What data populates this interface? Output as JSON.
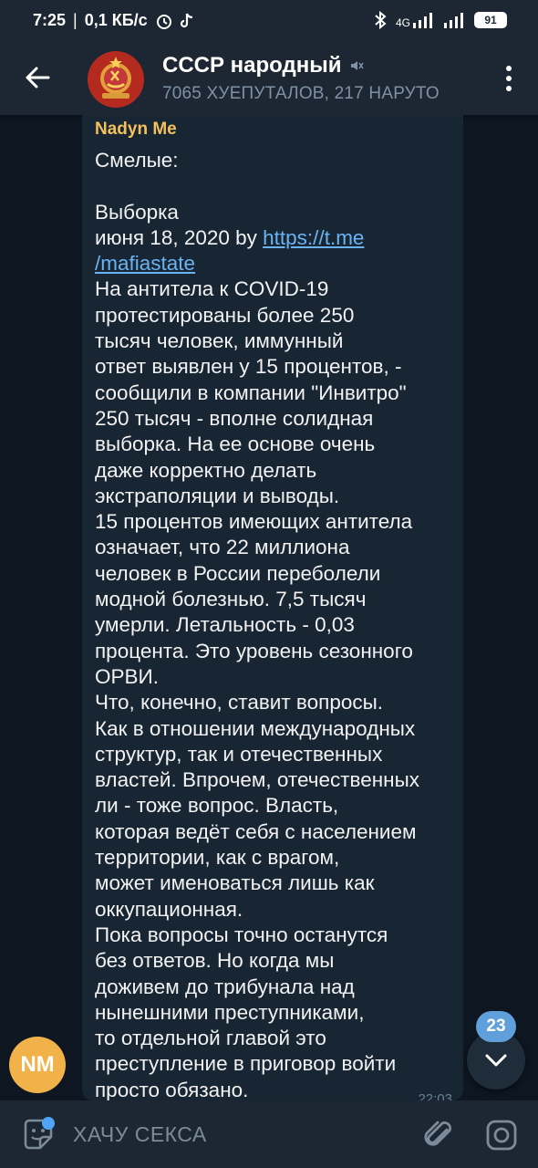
{
  "status_bar": {
    "time": "7:25",
    "speed": "0,1 КБ/с",
    "network_label": "4G",
    "battery": "91",
    "icons": [
      "alarm-icon",
      "tiktok-icon",
      "bluetooth-icon",
      "signal-icon",
      "signal-icon"
    ]
  },
  "header": {
    "title": "СССР народный",
    "subtitle": "7065 ХУЕПУТАЛОВ, 217 НАРУТО",
    "muted_icon": "mute-icon"
  },
  "message": {
    "sender": "Nadyn Me",
    "lines_before_link": "Смелые:\n\nВыборка\nиюня 18, 2020 by ",
    "link": "https://t.me\n/mafiastate",
    "lines_after_link": "\nНа антитела к COVID-19\nпротестированы более 250\nтысяч человек, иммунный\nответ выявлен у 15 процентов, -\nсообщили в компании \"Инвитро\"\n250 тысяч - вполне солидная\nвыборка. На ее основе очень\nдаже корректно делать\nэкстраполяции и выводы.\n15 процентов имеющих антитела\nозначает, что 22 миллиона\nчеловек в России переболели\nмодной болезнью. 7,5 тысяч\nумерли. Летальность - 0,03\nпроцента. Это уровень сезонного\nОРВИ.\nЧто, конечно, ставит вопросы.\nКак в отношении международных\nструктур, так и отечественных\nвластей. Впрочем, отечественных\nли - тоже вопрос. Власть,\nкоторая ведёт себя с населением\nтерритории, как с врагом,\nможет именоваться лишь как\nоккупационная.\nПока вопросы точно останутся\nбез ответов. Но когда мы\nдоживем до трибунала над\nнынешними преступниками,\nто отдельной главой это\nпреступление в приговор войти\nпросто обязано.",
    "time": "22:03"
  },
  "sender_avatar": {
    "initials": "NM",
    "color": "#f2b24a"
  },
  "scroll": {
    "unread_count": "23"
  },
  "input": {
    "placeholder": "ХАЧУ СЕКСА"
  },
  "colors": {
    "background": "#0e1621",
    "bar": "#1c2733",
    "bubble": "#182533",
    "sender_name": "#f4c05b",
    "link": "#6ab3f3",
    "accent": "#5fa0db"
  }
}
